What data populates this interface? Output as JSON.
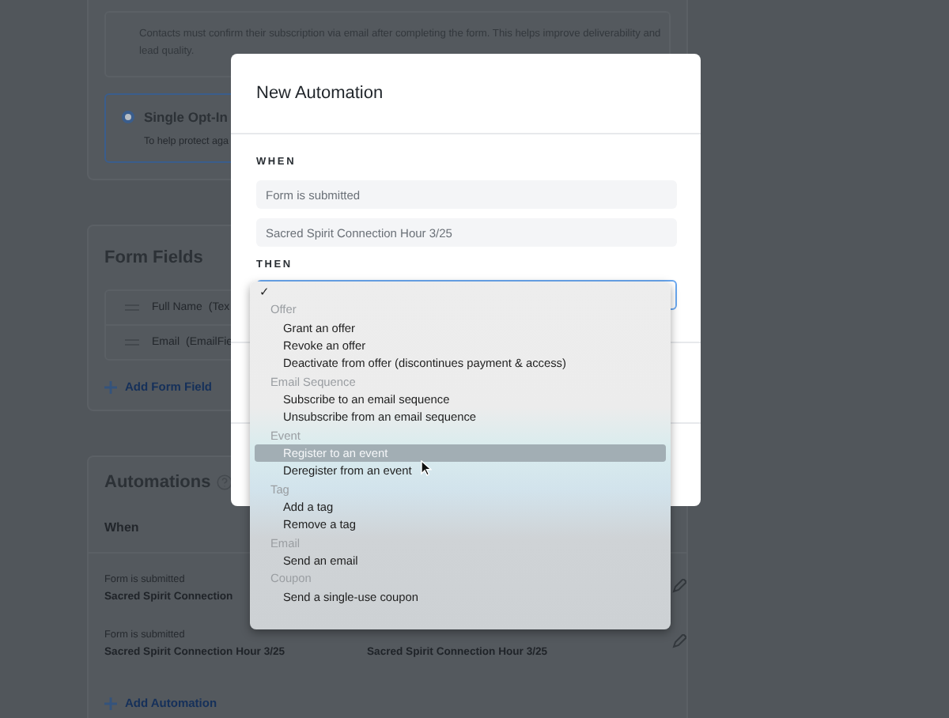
{
  "background_page": {
    "opt_in": {
      "description": "Contacts must confirm their subscription via email after completing the form. This helps improve deliverability and lead quality.",
      "option": {
        "title": "Single Opt-In",
        "subtitle": "To help protect aga",
        "selected": true
      }
    },
    "form_fields": {
      "title": "Form Fields",
      "fields": [
        {
          "label": "Full Name",
          "type": "(Tex"
        },
        {
          "label": "Email",
          "type": "(EmailFie"
        }
      ],
      "add_link": "Add Form Field"
    },
    "automations": {
      "title": "Automations",
      "column_1": "When",
      "rows": [
        {
          "event": "Form is submitted",
          "target": "Sacred Spirit Connection"
        },
        {
          "event": "Form is submitted",
          "target": "Sacred Spirit Connection Hour 3/25",
          "column_2": "Sacred Spirit Connection Hour 3/25"
        }
      ],
      "add_link": "Add Automation"
    }
  },
  "modal": {
    "title": "New Automation",
    "when_label": "WHEN",
    "when_fields": [
      "Form is submitted",
      "Sacred Spirit Connection Hour 3/25"
    ],
    "then_label": "THEN"
  },
  "dropdown": {
    "items": [
      {
        "kind": "check",
        "text": "✓"
      },
      {
        "kind": "group",
        "text": "Offer"
      },
      {
        "kind": "option",
        "text": "Grant an offer",
        "selected": false
      },
      {
        "kind": "option",
        "text": "Revoke an offer",
        "selected": false
      },
      {
        "kind": "option",
        "text": "Deactivate from offer (discontinues payment & access)",
        "selected": false
      },
      {
        "kind": "group",
        "text": "Email Sequence"
      },
      {
        "kind": "option",
        "text": "Subscribe to an email sequence",
        "selected": false
      },
      {
        "kind": "option",
        "text": "Unsubscribe from an email sequence",
        "selected": false
      },
      {
        "kind": "group",
        "text": "Event"
      },
      {
        "kind": "option",
        "text": "Register to an event",
        "selected": true
      },
      {
        "kind": "option",
        "text": "Deregister from an event",
        "selected": false
      },
      {
        "kind": "group",
        "text": "Tag"
      },
      {
        "kind": "option",
        "text": "Add a tag",
        "selected": false
      },
      {
        "kind": "option",
        "text": "Remove a tag",
        "selected": false
      },
      {
        "kind": "group",
        "text": "Email"
      },
      {
        "kind": "option",
        "text": "Send an email",
        "selected": false
      },
      {
        "kind": "group",
        "text": "Coupon"
      },
      {
        "kind": "option",
        "text": "Send a single-use coupon",
        "selected": false
      }
    ]
  }
}
